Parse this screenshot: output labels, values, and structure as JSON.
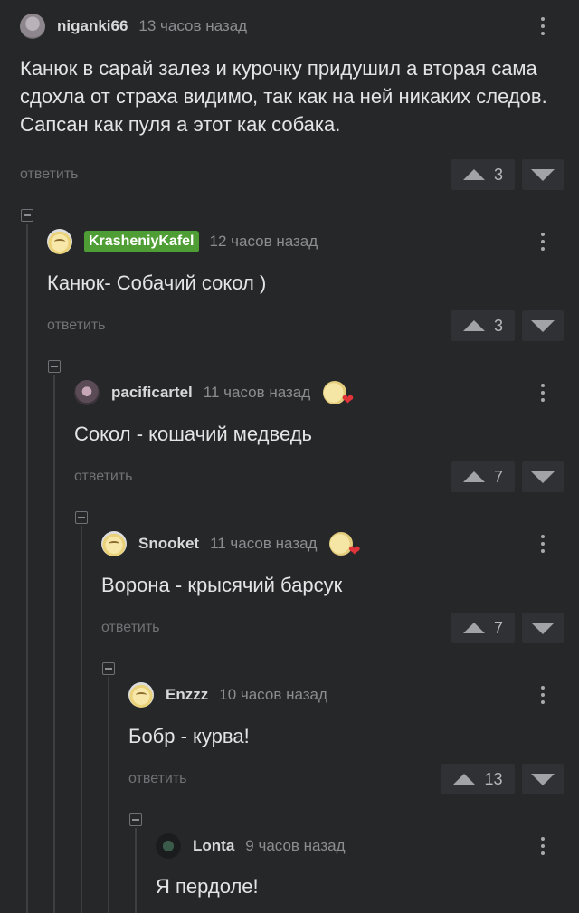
{
  "comments": [
    {
      "user": "niganki66",
      "time": "13 часов назад",
      "text": "Канюк в сарай залез и курочку придушил а вторая сама сдохла от страха видимо, так как на ней никаких следов. Сапсан как пуля а этот как собака.",
      "reply": "ответить",
      "score": "3",
      "avatar": "gray-avatar"
    },
    {
      "user": "KrasheniyKafel",
      "time": "12 часов назад",
      "text": "Канюк- Собачий сокол )",
      "reply": "ответить",
      "score": "3",
      "avatar": "face-avatar",
      "badge_color": "#4f9e35"
    },
    {
      "user": "pacificartel",
      "time": "11 часов назад",
      "text": "Сокол - кошачий медведь",
      "reply": "ответить",
      "score": "7",
      "avatar": "dark-avatar",
      "reaction": "heart-face-emoji"
    },
    {
      "user": "Snooket",
      "time": "11 часов назад",
      "text": "Ворона - крысячий барсук",
      "reply": "ответить",
      "score": "7",
      "avatar": "face-avatar",
      "reaction": "heart-face-emoji"
    },
    {
      "user": "Enzzz",
      "time": "10 часов назад",
      "text": "Бобр - курва!",
      "reply": "ответить",
      "score": "13",
      "avatar": "face-avatar"
    },
    {
      "user": "Lonta",
      "time": "9 часов назад",
      "text": "Я пердоле!",
      "avatar": "cat-avatar"
    }
  ],
  "theme": {
    "background": "#262729",
    "badge": "#4f9e35",
    "heart": "#e0343a"
  }
}
